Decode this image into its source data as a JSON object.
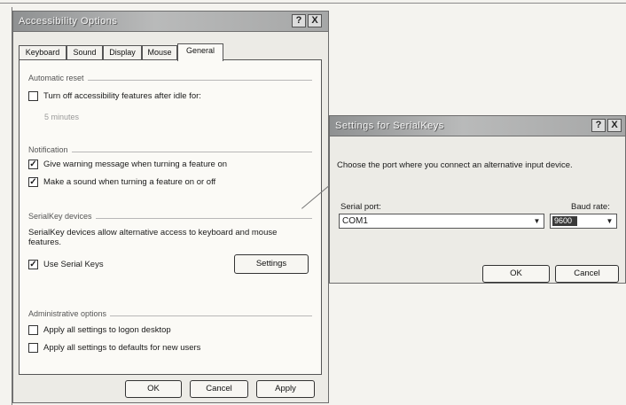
{
  "main_dialog": {
    "title": "Accessibility Options",
    "help_btn": "?",
    "close_btn": "X",
    "tabs": [
      "Keyboard",
      "Sound",
      "Display",
      "Mouse",
      "General"
    ],
    "automatic_reset": {
      "heading": "Automatic reset",
      "turn_off_label": "Turn off accessibility features after idle for:",
      "faint_text": "5 minutes"
    },
    "notification": {
      "heading": "Notification",
      "warning_label": "Give warning message when turning a feature on",
      "sound_label": "Make a sound when turning a feature on or off"
    },
    "serialkey_devices": {
      "heading": "SerialKey devices",
      "description": "SerialKey devices allow alternative access to keyboard and mouse features.",
      "use_label": "Use Serial Keys",
      "settings_button": "Settings"
    },
    "administrative": {
      "heading": "Administrative options",
      "logon_label": "Apply all settings to logon desktop",
      "defaults_label": "Apply all settings to defaults for new users"
    },
    "buttons": {
      "ok": "OK",
      "cancel": "Cancel",
      "apply": "Apply"
    }
  },
  "serial_dialog": {
    "title": "Settings for SerialKeys",
    "help_btn": "?",
    "close_btn": "X",
    "instruction": "Choose the port where you connect an alternative input device.",
    "serial_port_label": "Serial port:",
    "serial_port_value": "COM1",
    "baud_rate_label": "Baud rate:",
    "baud_rate_value": "9600",
    "ok": "OK",
    "cancel": "Cancel"
  },
  "checkbox_states": {
    "turn_off": false,
    "warning": true,
    "sound": true,
    "use_serial_keys": true,
    "logon": false,
    "defaults": false
  }
}
